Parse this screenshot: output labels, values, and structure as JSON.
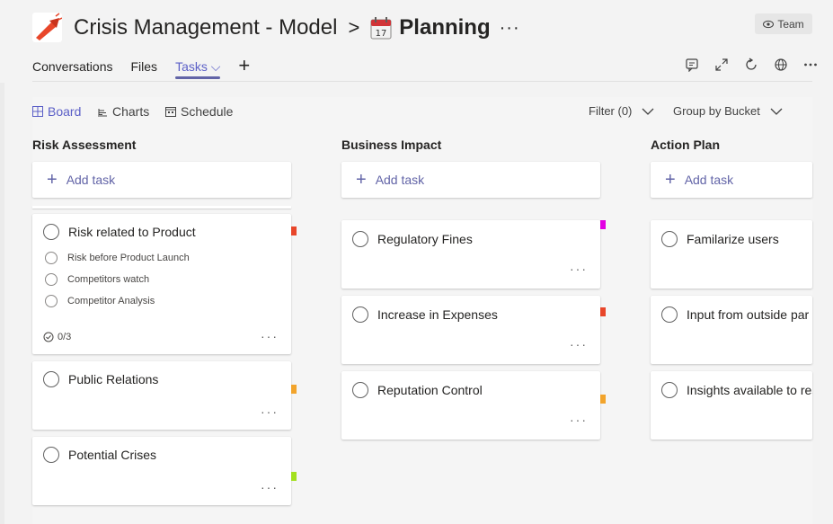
{
  "header": {
    "team_name": "Crisis Management - Model",
    "separator": ">",
    "tab_name": "Planning",
    "more": "···",
    "badge": "Team"
  },
  "nav": {
    "tabs": [
      {
        "label": "Conversations"
      },
      {
        "label": "Files"
      },
      {
        "label": "Tasks ⌵"
      }
    ],
    "add": "+"
  },
  "header_icons": [
    "chat-icon",
    "expand-icon",
    "refresh-icon",
    "globe-icon",
    "more-icon"
  ],
  "toolbar": {
    "board": "Board",
    "charts": "Charts",
    "schedule": "Schedule",
    "filter": "Filter (0)",
    "group": "Group by Bucket"
  },
  "colors": {
    "accent": "#6264a7",
    "label_red": "#e8462a",
    "label_orange": "#f2a42c",
    "label_magenta": "#e300e3",
    "label_lime": "#a3e01e"
  },
  "buckets": [
    {
      "title": "Risk Assessment",
      "add_task": "Add task",
      "tasks": [
        {
          "title": "Risk related to Product",
          "checklist": [
            "Risk before Product Launch",
            "Competitors watch",
            "Competitor Analysis"
          ],
          "progress": "0/3",
          "more": "···"
        },
        {
          "title": "Public Relations",
          "more": "···"
        },
        {
          "title": "Potential Crises",
          "more": "···"
        }
      ]
    },
    {
      "title": "Business Impact",
      "add_task": "Add task",
      "tasks": [
        {
          "title": "Regulatory Fines",
          "more": "···"
        },
        {
          "title": "Increase in Expenses",
          "more": "···"
        },
        {
          "title": "Reputation Control",
          "more": "···"
        }
      ]
    },
    {
      "title": "Action Plan",
      "add_task": "Add task",
      "tasks": [
        {
          "title": "Familarize users"
        },
        {
          "title": "Input from outside par"
        },
        {
          "title": "Insights available to res"
        }
      ]
    }
  ]
}
